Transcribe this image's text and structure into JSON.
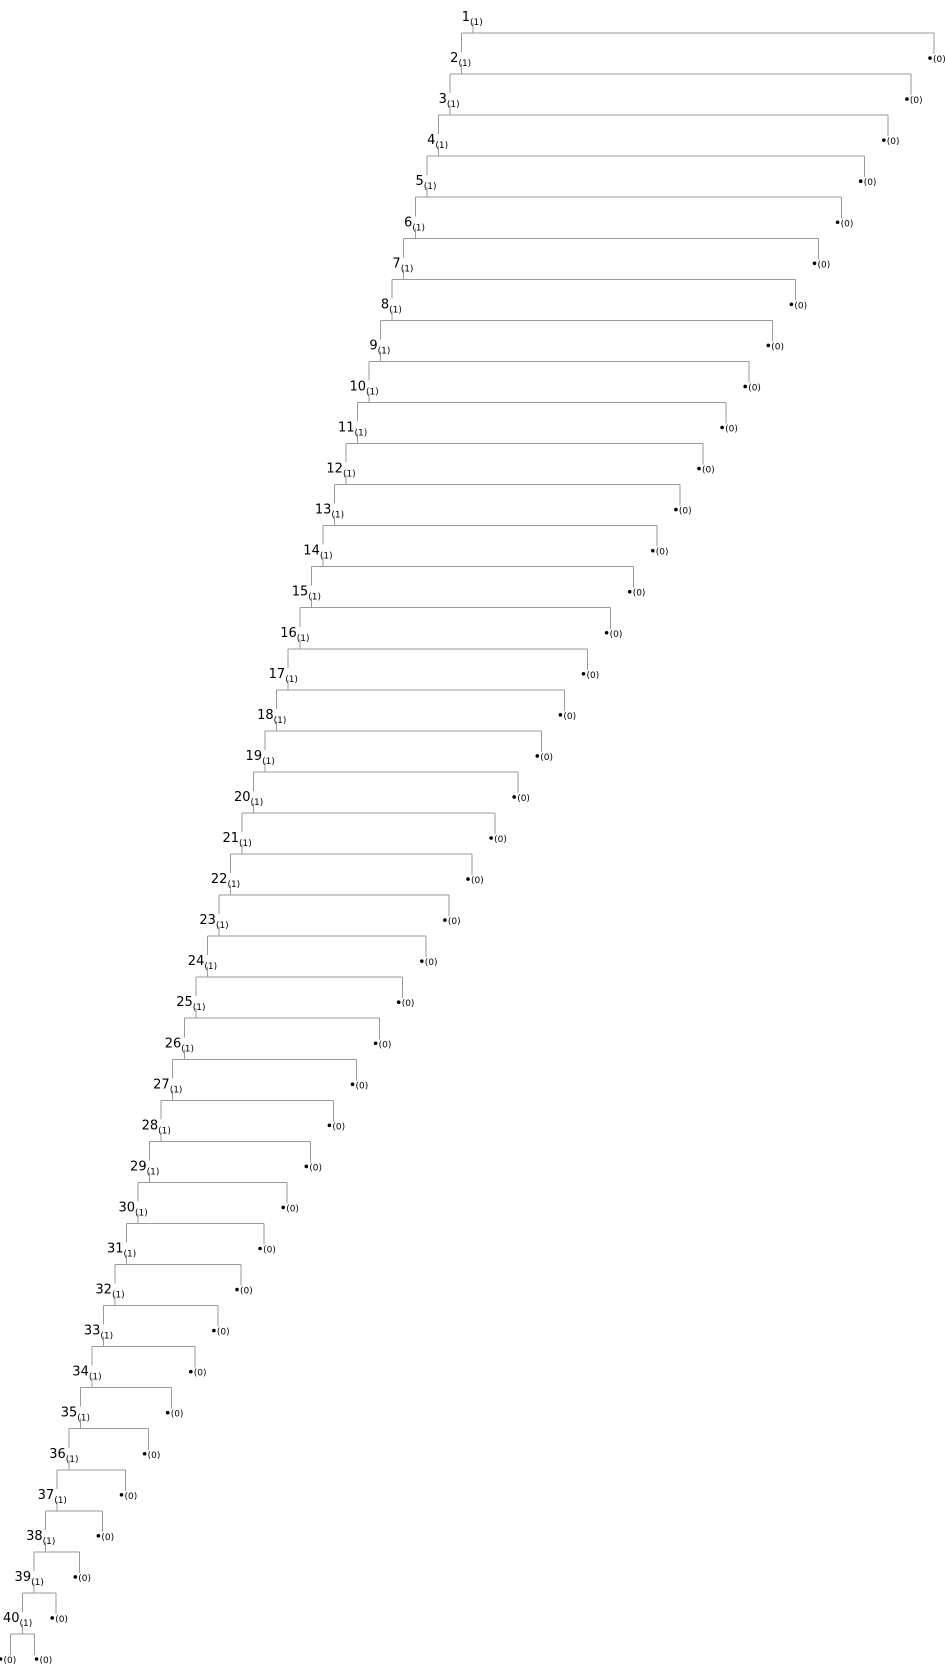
{
  "tree": {
    "internal_nodes": [
      {
        "id": "1",
        "count": "(1)"
      },
      {
        "id": "2",
        "count": "(1)"
      },
      {
        "id": "3",
        "count": "(1)"
      },
      {
        "id": "4",
        "count": "(1)"
      },
      {
        "id": "5",
        "count": "(1)"
      },
      {
        "id": "6",
        "count": "(1)"
      },
      {
        "id": "7",
        "count": "(1)"
      },
      {
        "id": "8",
        "count": "(1)"
      },
      {
        "id": "9",
        "count": "(1)"
      },
      {
        "id": "10",
        "count": "(1)"
      },
      {
        "id": "11",
        "count": "(1)"
      },
      {
        "id": "12",
        "count": "(1)"
      },
      {
        "id": "13",
        "count": "(1)"
      },
      {
        "id": "14",
        "count": "(1)"
      },
      {
        "id": "15",
        "count": "(1)"
      },
      {
        "id": "16",
        "count": "(1)"
      },
      {
        "id": "17",
        "count": "(1)"
      },
      {
        "id": "18",
        "count": "(1)"
      },
      {
        "id": "19",
        "count": "(1)"
      },
      {
        "id": "20",
        "count": "(1)"
      },
      {
        "id": "21",
        "count": "(1)"
      },
      {
        "id": "22",
        "count": "(1)"
      },
      {
        "id": "23",
        "count": "(1)"
      },
      {
        "id": "24",
        "count": "(1)"
      },
      {
        "id": "25",
        "count": "(1)"
      },
      {
        "id": "26",
        "count": "(1)"
      },
      {
        "id": "27",
        "count": "(1)"
      },
      {
        "id": "28",
        "count": "(1)"
      },
      {
        "id": "29",
        "count": "(1)"
      },
      {
        "id": "30",
        "count": "(1)"
      },
      {
        "id": "31",
        "count": "(1)"
      },
      {
        "id": "32",
        "count": "(1)"
      },
      {
        "id": "33",
        "count": "(1)"
      },
      {
        "id": "34",
        "count": "(1)"
      },
      {
        "id": "35",
        "count": "(1)"
      },
      {
        "id": "36",
        "count": "(1)"
      },
      {
        "id": "37",
        "count": "(1)"
      },
      {
        "id": "38",
        "count": "(1)"
      },
      {
        "id": "39",
        "count": "(1)"
      },
      {
        "id": "40",
        "count": "(1)"
      }
    ],
    "leaf_label": "(0)",
    "edge_color": "#9a9a9a",
    "text_color": "#000000"
  }
}
